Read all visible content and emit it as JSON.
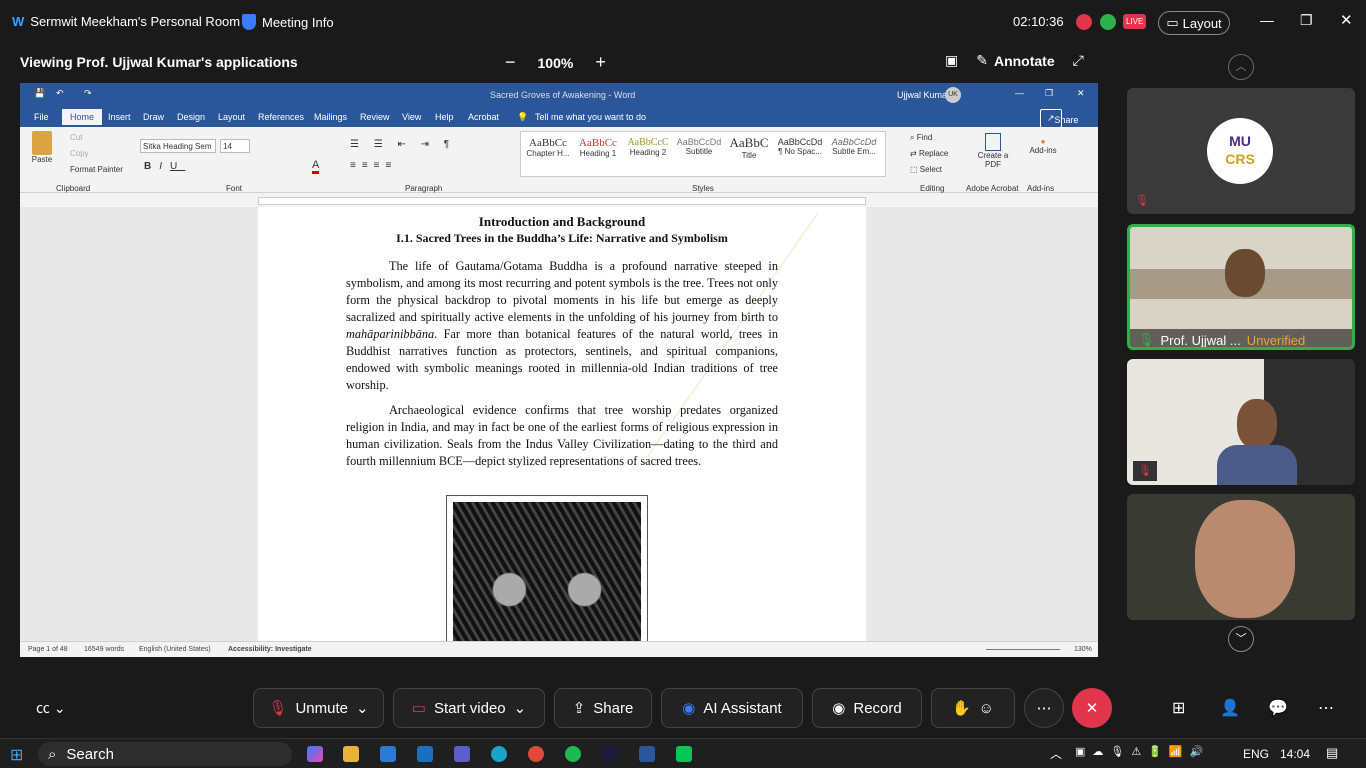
{
  "top": {
    "room": "Sermwit Meekham's Personal Room",
    "meeting_info": "Meeting Info",
    "time": "02:10:36",
    "live": "LIVE",
    "layout": "Layout"
  },
  "viewing": {
    "title": "Viewing Prof. Ujjwal Kumar's applications",
    "zoom": "100%",
    "annotate": "Annotate"
  },
  "word": {
    "doc_title": "Sacred Groves of Awakening  -  Word",
    "user": "Ujjwal Kumar",
    "user_initials": "UK",
    "tabs": [
      "File",
      "Home",
      "Insert",
      "Draw",
      "Design",
      "Layout",
      "References",
      "Mailings",
      "Review",
      "View",
      "Help",
      "Acrobat"
    ],
    "tell": "Tell me what you want to do",
    "share": "Share",
    "clipboard": {
      "paste": "Paste",
      "cut": "Cut",
      "copy": "Copy",
      "painter": "Format Painter",
      "group": "Clipboard"
    },
    "font": {
      "name": "Sitka Heading Sem",
      "size": "14",
      "group": "Font"
    },
    "paragraph_group": "Paragraph",
    "styles": [
      {
        "sample": "AaBbCc",
        "name": "Chapter H..."
      },
      {
        "sample": "AaBbCc",
        "name": "Heading 1"
      },
      {
        "sample": "AaBbCcC",
        "name": "Heading 2"
      },
      {
        "sample": "AaBbCcDd",
        "name": "Subtitle"
      },
      {
        "sample": "AaBbC",
        "name": "Title"
      },
      {
        "sample": "AaBbCcDd",
        "name": "¶ No Spac..."
      },
      {
        "sample": "AaBbCcDd",
        "name": "Subtle Em..."
      }
    ],
    "styles_group": "Styles",
    "editing": {
      "find": "Find",
      "replace": "Replace",
      "select": "Select",
      "group": "Editing"
    },
    "acrobat": {
      "create": "Create a PDF",
      "group": "Adobe Acrobat"
    },
    "addins": {
      "label": "Add-ins",
      "group": "Add-ins"
    },
    "doc": {
      "heading1": "Introduction and Background",
      "heading2": "I.1. Sacred Trees in the Buddha’s Life: Narrative and Symbolism",
      "p1": "The life of Gautama/Gotama Buddha is a profound narrative steeped in symbolism, and among its most recurring and potent symbols is the tree. Trees not only form the physical backdrop to pivotal moments in his life but emerge as deeply sacralized and spiritually active elements in the unfolding of his journey from birth to ",
      "p1_em": "mahāparinibbāna",
      "p1_rest": ". Far more than botanical features of the natural world, trees in Buddhist narratives function as protectors, sentinels, and spiritual companions, endowed with symbolic meanings rooted in millennia-old Indian traditions of tree worship.",
      "p2": "Archaeological evidence confirms that tree worship predates organized religion in India, and may in fact be one of the earliest forms of religious expression in human civilization. Seals from the Indus Valley Civilization—dating to the third and fourth millennium BCE—depict stylized representations of sacred trees."
    },
    "status": {
      "page": "Page 1 of 48",
      "words": "16549 words",
      "lang": "English (United States)",
      "access": "Accessibility: Investigate",
      "zoom": "130%"
    }
  },
  "participants": [
    {
      "name": "Prof. Ujjwal ...",
      "status": "Unverified"
    }
  ],
  "logo": {
    "line1": "MU",
    "line2": "CRS"
  },
  "bottom": {
    "unmute": "Unmute",
    "video": "Start video",
    "share": "Share",
    "ai": "AI Assistant",
    "record": "Record"
  },
  "taskbar": {
    "search": "Search",
    "lang": "ENG",
    "clock": "14:04"
  }
}
